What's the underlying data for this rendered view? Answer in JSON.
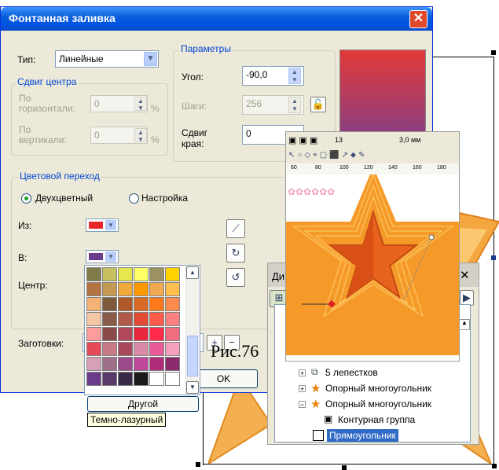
{
  "caption": "Рис.76",
  "dialog": {
    "title": "Фонтанная заливка",
    "type_label": "Тип:",
    "type_value": "Линейные",
    "center_offset_title": "Сдвиг центра",
    "horizontal_label": "По горизонтали:",
    "horizontal_value": "0",
    "vertical_label": "По вертикали:",
    "vertical_value": "0",
    "percent": "%",
    "params_title": "Параметры",
    "angle_label": "Угол:",
    "angle_value": "-90,0",
    "steps_label": "Шаги:",
    "steps_value": "256",
    "edge_label": "Сдвиг края:",
    "edge_value": "0",
    "blend_title": "Цветовой переход",
    "two_color_label": "Двухцветный",
    "custom_label": "Настройка",
    "from_label": "Из:",
    "to_label": "В:",
    "mid_label": "Центр:",
    "presets_label": "Заготовки:",
    "ok_label": "OK",
    "from_color": "#e8262b",
    "to_color": "#6a3b8a",
    "preview_top": "#e23a38",
    "preview_bottom": "#7b3f8e"
  },
  "palette": {
    "colors": [
      "#7f7a4a",
      "#c7c05e",
      "#e6e64d",
      "#ffff66",
      "#9c9163",
      "#ffd200",
      "#b37442",
      "#c49a52",
      "#f2a93b",
      "#ff9900",
      "#f2a952",
      "#ffbe4d",
      "#f6b275",
      "#7c5a3a",
      "#b05a2a",
      "#d86a25",
      "#ff7a1a",
      "#ff8a4d",
      "#f4c8a4",
      "#8a5a4a",
      "#b05a4a",
      "#e14a34",
      "#ff5a4a",
      "#ff8080",
      "#ff9c9c",
      "#8a4a4a",
      "#b0485a",
      "#e8263c",
      "#ff2a4a",
      "#f26d7d",
      "#e64a5a",
      "#c87a86",
      "#a8485a",
      "#d88aa8",
      "#e85a9a",
      "#f7a0bd",
      "#d8a0b8",
      "#a0708a",
      "#9a4a8a",
      "#c0489a",
      "#b02a7a",
      "#8a2a6a",
      "#6a3b8a",
      "#5a3a6a",
      "#3a2a4a",
      "#1a1a1a",
      "#ffffff",
      "#ffffff"
    ],
    "other_label": "Другой",
    "tooltip": "Темно-лазурный"
  },
  "docker": {
    "tab_label": "Ди",
    "items": [
      {
        "label": "5 лепестков",
        "expander": "+"
      },
      {
        "label": "Опорный многоугольник",
        "expander": "+"
      },
      {
        "label": "Опорный многоугольник",
        "expander": "−"
      },
      {
        "label": "Контурная группа",
        "expander": ""
      },
      {
        "label": "Прямоугольник",
        "expander": ""
      }
    ]
  },
  "workspace": {
    "size_value": "13",
    "outline_value": "3,0 мм",
    "ruler_ticks": [
      "60",
      "80",
      "100",
      "120",
      "140",
      "160",
      "180"
    ]
  }
}
